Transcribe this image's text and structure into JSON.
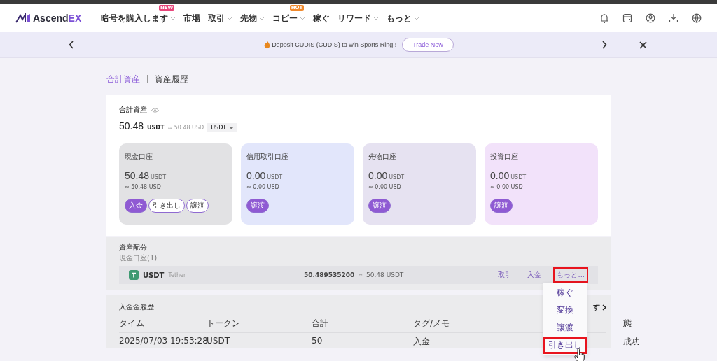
{
  "logo": {
    "text": "Ascend",
    "accent": "EX"
  },
  "nav": [
    {
      "label": "暗号を購入します",
      "has_menu": true,
      "badge": "NEW",
      "color": "#e8457a"
    },
    {
      "label": "市場",
      "has_menu": false
    },
    {
      "label": "取引",
      "has_menu": true
    },
    {
      "label": "先物",
      "has_menu": true
    },
    {
      "label": "コピー",
      "has_menu": true,
      "badge": "HOT",
      "color": "#f0892c"
    },
    {
      "label": "稼ぐ",
      "has_menu": false
    },
    {
      "label": "リワード",
      "has_menu": true
    },
    {
      "label": "もっと",
      "has_menu": true
    }
  ],
  "banner": {
    "text": "Deposit CUDIS (CUDIS) to win Sports Ring !",
    "button": "Trade Now"
  },
  "breadcrumb": [
    {
      "label": "合計資産",
      "selected": true
    },
    {
      "label": "資産履歴",
      "selected": false
    }
  ],
  "summary": {
    "title": "合計資産",
    "amount": "50.48",
    "unit": "USDT",
    "approx": "≈ 50.48 USD",
    "currency": "USDT"
  },
  "accounts": [
    {
      "name": "現金口座",
      "amount": "50.48",
      "unit": "USDT",
      "approx": "≈ 50.48 USD",
      "color": "#e2e2e4",
      "actions": [
        {
          "label": "入金",
          "filled": true
        },
        {
          "label": "引き出し",
          "filled": false
        },
        {
          "label": "譲渡",
          "filled": false
        }
      ]
    },
    {
      "name": "信用取引口座",
      "amount": "0.00",
      "unit": "USDT",
      "approx": "≈ 0.00 USD",
      "color": "#e2e6fb",
      "actions": [
        {
          "label": "譲渡",
          "filled": true
        }
      ]
    },
    {
      "name": "先物口座",
      "amount": "0.00",
      "unit": "USDT",
      "approx": "≈ 0.00 USD",
      "color": "#e6e2f1",
      "actions": [
        {
          "label": "譲渡",
          "filled": true
        }
      ]
    },
    {
      "name": "投資口座",
      "amount": "0.00",
      "unit": "USDT",
      "approx": "≈ 0.00 USD",
      "color": "#f2e2fa",
      "actions": [
        {
          "label": "譲渡",
          "filled": true
        }
      ]
    }
  ],
  "allocation": {
    "title": "資産配分",
    "subtitle": "現金口座(1)",
    "row": {
      "symbol": "USDT",
      "name": "Tether",
      "balance": "50.489535200",
      "approx_sign": "≈",
      "value": "50.48 USDT",
      "actions": [
        {
          "label": "取引",
          "highlighted": false
        },
        {
          "label": "入金",
          "highlighted": false
        },
        {
          "label": "もっと...",
          "highlighted": true
        }
      ]
    },
    "menu": [
      {
        "label": "稼ぐ",
        "highlighted": false
      },
      {
        "label": "変換",
        "highlighted": false
      },
      {
        "label": "譲渡",
        "highlighted": false
      },
      {
        "label": "引き出し",
        "highlighted": true
      }
    ]
  },
  "history": {
    "title": "入金金履歴",
    "link_fragment": "す",
    "columns": [
      "タイム",
      "トークン",
      "合計",
      "タグ/メモ",
      "態"
    ],
    "rows": [
      [
        "2025/07/03 19:53:28",
        "USDT",
        "50",
        "入金",
        "成功"
      ]
    ]
  }
}
